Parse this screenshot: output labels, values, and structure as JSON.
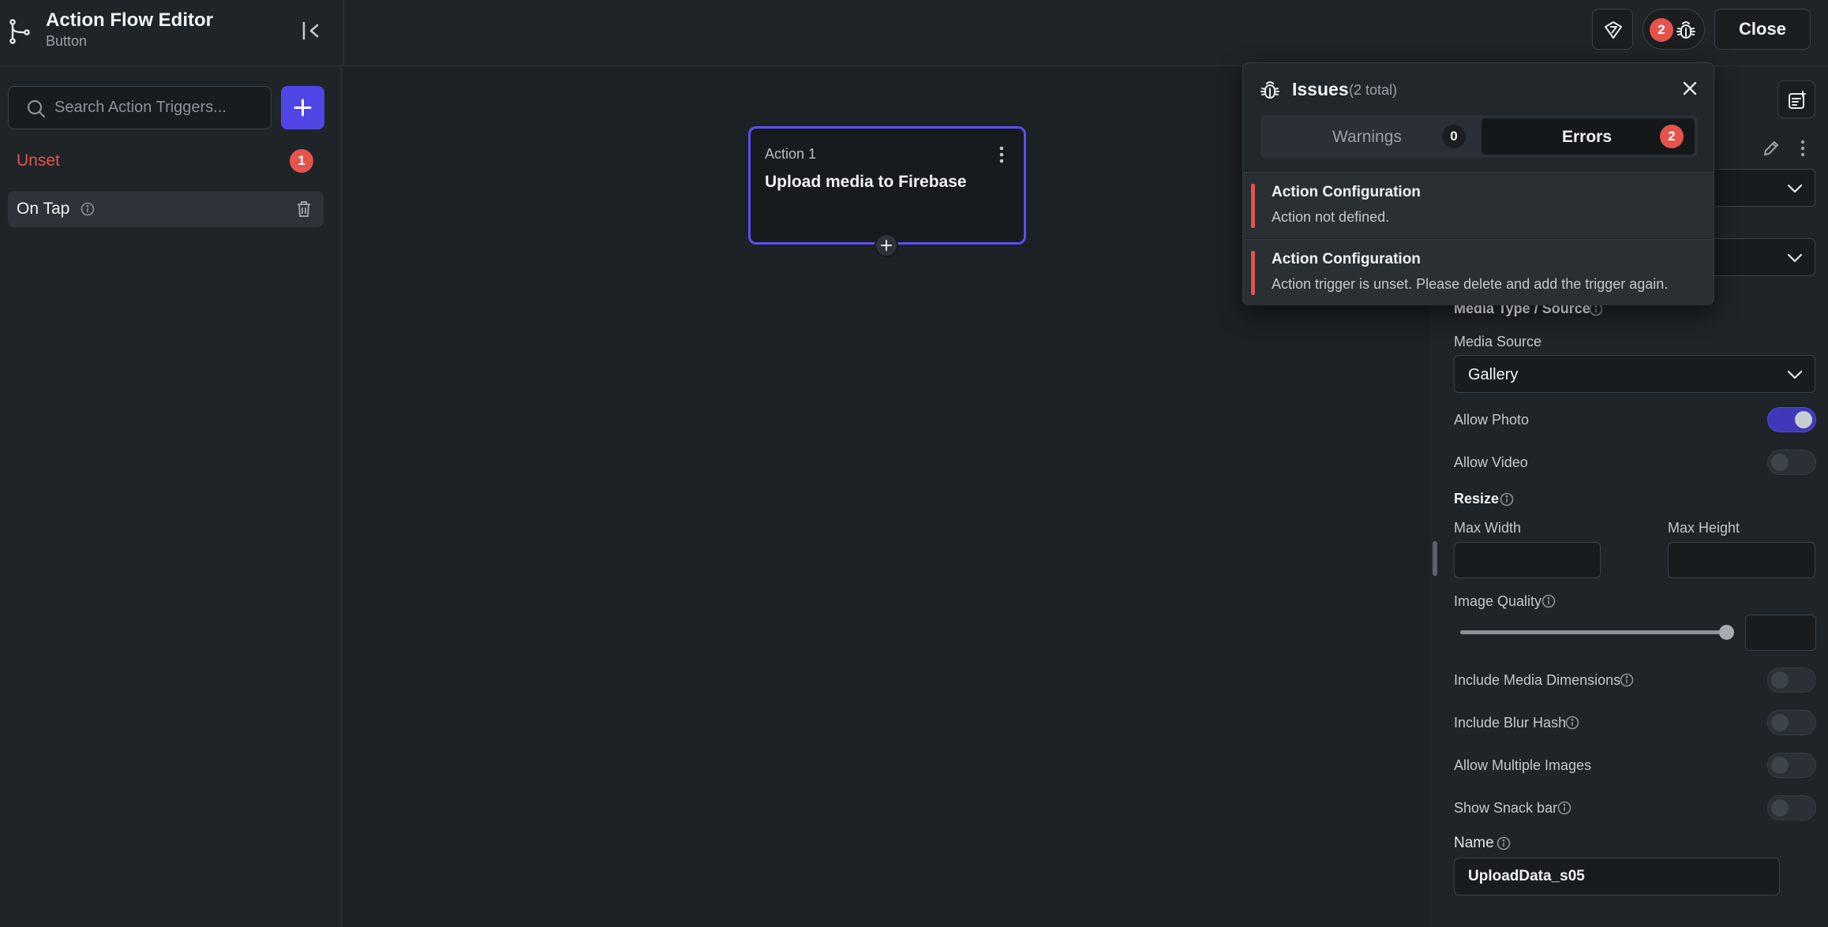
{
  "header": {
    "title": "Action Flow Editor",
    "subtitle": "Button",
    "close_label": "Close",
    "issues_count": "2",
    "icons": {
      "app": "flow-branch-icon",
      "collapse": "collapse-panel-icon",
      "logo": "flutterflow-logo-icon",
      "issues": "bug-icon"
    }
  },
  "sidebar": {
    "search": {
      "placeholder": "Search Action Triggers..."
    },
    "unset": {
      "label": "Unset",
      "count": "1"
    },
    "triggers": [
      {
        "label": "On Tap"
      }
    ]
  },
  "canvas": {
    "action_node": {
      "step": "Action 1",
      "title": "Upload media to Firebase"
    }
  },
  "issues_popover": {
    "title": "Issues",
    "total": "(2 total)",
    "tabs": [
      {
        "label": "Warnings",
        "count": "0"
      },
      {
        "label": "Errors",
        "count": "2"
      }
    ],
    "items": [
      {
        "title": "Action Configuration",
        "description": "Action not defined."
      },
      {
        "title": "Action Configuration",
        "description": "Action trigger is unset. Please delete and add the trigger again."
      }
    ]
  },
  "properties": {
    "media_section_heading": "Media Type / Source",
    "media_source_label": "Media Source",
    "media_source_value": "Gallery",
    "allow_photo_label": "Allow Photo",
    "allow_photo": true,
    "allow_video_label": "Allow Video",
    "allow_video": false,
    "resize_heading": "Resize",
    "max_width_label": "Max Width",
    "max_width_value": "",
    "max_height_label": "Max Height",
    "max_height_value": "",
    "image_quality_label": "Image Quality",
    "image_quality_value": "",
    "include_media_dimensions_label": "Include Media Dimensions",
    "include_media_dimensions": false,
    "include_blur_hash_label": "Include Blur Hash",
    "include_blur_hash": false,
    "allow_multiple_images_label": "Allow Multiple Images",
    "allow_multiple_images": false,
    "show_snack_bar_label": "Show Snack bar",
    "show_snack_bar": false,
    "name_label": "Name",
    "name_value": "UploadData_s05"
  },
  "colors": {
    "accent": "#4f46e5",
    "error": "#e5534b",
    "background": "#1c2125",
    "panel": "#1f2428"
  }
}
